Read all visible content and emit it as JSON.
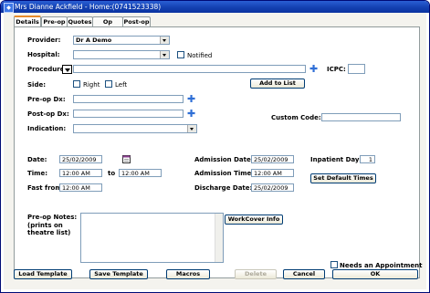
{
  "window": {
    "title": "Mrs Dianne Ackfield - Home:(0741523338)"
  },
  "tabs": [
    "Details",
    "Pre-op",
    "Quotes",
    "Op Notes",
    "Post-op"
  ],
  "active_tab": "Details",
  "form": {
    "provider_label": "Provider:",
    "provider_value": "Dr A Demo",
    "hospital_label": "Hospital:",
    "hospital_value": "",
    "notified_label": "Notified",
    "procedure_label": "Procedure:",
    "procedure_value": "",
    "icpc_label": "ICPC:",
    "icpc_value": "",
    "side_label": "Side:",
    "right_label": "Right",
    "left_label": "Left",
    "add_to_list_label": "Add to List",
    "preop_dx_label": "Pre-op Dx:",
    "preop_dx_value": "",
    "postop_dx_label": "Post-op Dx:",
    "postop_dx_value": "",
    "indication_label": "Indication:",
    "indication_value": "",
    "custom_code_label": "Custom Code:",
    "custom_code_value": "",
    "date_label": "Date:",
    "date_value": "25/02/2009",
    "time_label": "Time:",
    "time_from": "12:00 AM",
    "to_label": "to",
    "time_to": "12:00 AM",
    "fast_from_label": "Fast from:",
    "fast_from_value": "12:00 AM",
    "admission_date_label": "Admission Date:",
    "admission_date_value": "25/02/2009",
    "admission_time_label": "Admission Time:",
    "admission_time_value": "12:00 AM",
    "discharge_date_label": "Discharge Date:",
    "discharge_date_value": "25/02/2009",
    "inpatient_days_label": "Inpatient Days:",
    "inpatient_days_value": "1",
    "set_default_times_label": "Set Default Times",
    "preop_notes_label": "Pre-op Notes:",
    "preop_notes_sub": "(prints on theatre list)",
    "preop_notes_value": "",
    "workcover_label": "WorkCover Info",
    "needs_appointment_label": "Needs an Appointment"
  },
  "footer": {
    "load_template": "Load Template",
    "save_template": "Save Template",
    "macros": "Macros",
    "delete": "Delete",
    "cancel": "Cancel",
    "ok": "OK"
  },
  "colors": {
    "titlebar": "#123fb0",
    "active_tab_accent": "#e68b2c",
    "plus_icon": "#2f6fd6"
  }
}
